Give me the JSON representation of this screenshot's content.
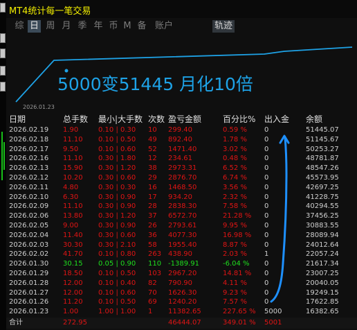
{
  "app": {
    "title": "MT4统计每一笔交易"
  },
  "tabs": [
    "综",
    "日",
    "周",
    "月",
    "季",
    "年",
    "币",
    "M",
    "备",
    "账户"
  ],
  "active_tab_index": 1,
  "trail_tab": "轨迹",
  "equity_chart": {
    "promo_text": "5000变51445 月化10倍",
    "start_date": "2026.01.23",
    "line_color": "#1ea2e6"
  },
  "table": {
    "headers": [
      "日期",
      "总手数",
      "最小|大手数",
      "次数",
      "盈亏金额",
      "百分比%",
      "出入金",
      "余额"
    ],
    "rows": [
      [
        "2026.02.19",
        "1.90",
        "0.10 | 0.30",
        "10",
        "299.40",
        "0.59 %",
        "0",
        "51445.07"
      ],
      [
        "2026.02.18",
        "11.10",
        "0.10 | 0.50",
        "49",
        "892.40",
        "1.78 %",
        "0",
        "51145.67"
      ],
      [
        "2026.02.17",
        "9.50",
        "0.10 | 0.60",
        "52",
        "1471.40",
        "3.02 %",
        "0",
        "50253.27"
      ],
      [
        "2026.02.16",
        "11.10",
        "0.30 | 1.80",
        "12",
        "234.61",
        "0.48 %",
        "0",
        "48781.87"
      ],
      [
        "2026.02.13",
        "15.90",
        "0.30 | 1.20",
        "38",
        "2973.31",
        "6.52 %",
        "0",
        "48547.26"
      ],
      [
        "2026.02.12",
        "10.20",
        "0.30 | 0.60",
        "29",
        "2876.70",
        "6.74 %",
        "0",
        "45573.95"
      ],
      [
        "2026.02.11",
        "4.80",
        "0.30 | 0.30",
        "16",
        "1468.50",
        "3.56 %",
        "0",
        "42697.25"
      ],
      [
        "2026.02.10",
        "6.30",
        "0.30 | 0.90",
        "17",
        "934.20",
        "2.32 %",
        "0",
        "41228.75"
      ],
      [
        "2026.02.09",
        "11.10",
        "0.30 | 0.90",
        "28",
        "2838.30",
        "7.58 %",
        "0",
        "40294.55"
      ],
      [
        "2026.02.06",
        "13.80",
        "0.30 | 1.20",
        "37",
        "6572.70",
        "21.28 %",
        "0",
        "37456.25"
      ],
      [
        "2026.02.05",
        "9.00",
        "0.30 | 0.90",
        "26",
        "2793.61",
        "9.95 %",
        "0",
        "30883.55"
      ],
      [
        "2026.02.04",
        "11.40",
        "0.30 | 0.60",
        "36",
        "4077.30",
        "16.98 %",
        "0",
        "28089.94"
      ],
      [
        "2026.02.03",
        "30.30",
        "0.30 | 2.10",
        "58",
        "1955.40",
        "8.87 %",
        "0",
        "24012.64"
      ],
      [
        "2026.02.02",
        "41.70",
        "0.10 | 0.80",
        "263",
        "438.90",
        "2.03 %",
        "1",
        "22057.24"
      ],
      [
        "2026.01.30",
        "30.15",
        "0.05 | 0.90",
        "110",
        "-1389.91",
        "-6.04 %",
        "0",
        "21617.34"
      ],
      [
        "2026.01.29",
        "18.50",
        "0.10 | 0.50",
        "103",
        "2967.20",
        "14.81 %",
        "0",
        "23007.25"
      ],
      [
        "2026.01.28",
        "12.00",
        "0.10 | 0.40",
        "82",
        "790.90",
        "4.11 %",
        "0",
        "20040.05"
      ],
      [
        "2026.01.27",
        "12.00",
        "0.10 | 0.60",
        "70",
        "1626.30",
        "9.23 %",
        "0",
        "19249.15"
      ],
      [
        "2026.01.26",
        "11.20",
        "0.10 | 0.50",
        "69",
        "1240.20",
        "7.57 %",
        "0",
        "17622.85"
      ],
      [
        "2026.01.23",
        "1.00",
        "1.00 | 1.00",
        "1",
        "11382.65",
        "227.65 %",
        "5000",
        "16382.65"
      ]
    ],
    "footer": [
      "合计",
      "272.95",
      "",
      "",
      "46444.07",
      "349.01 %",
      "5001",
      ""
    ]
  }
}
